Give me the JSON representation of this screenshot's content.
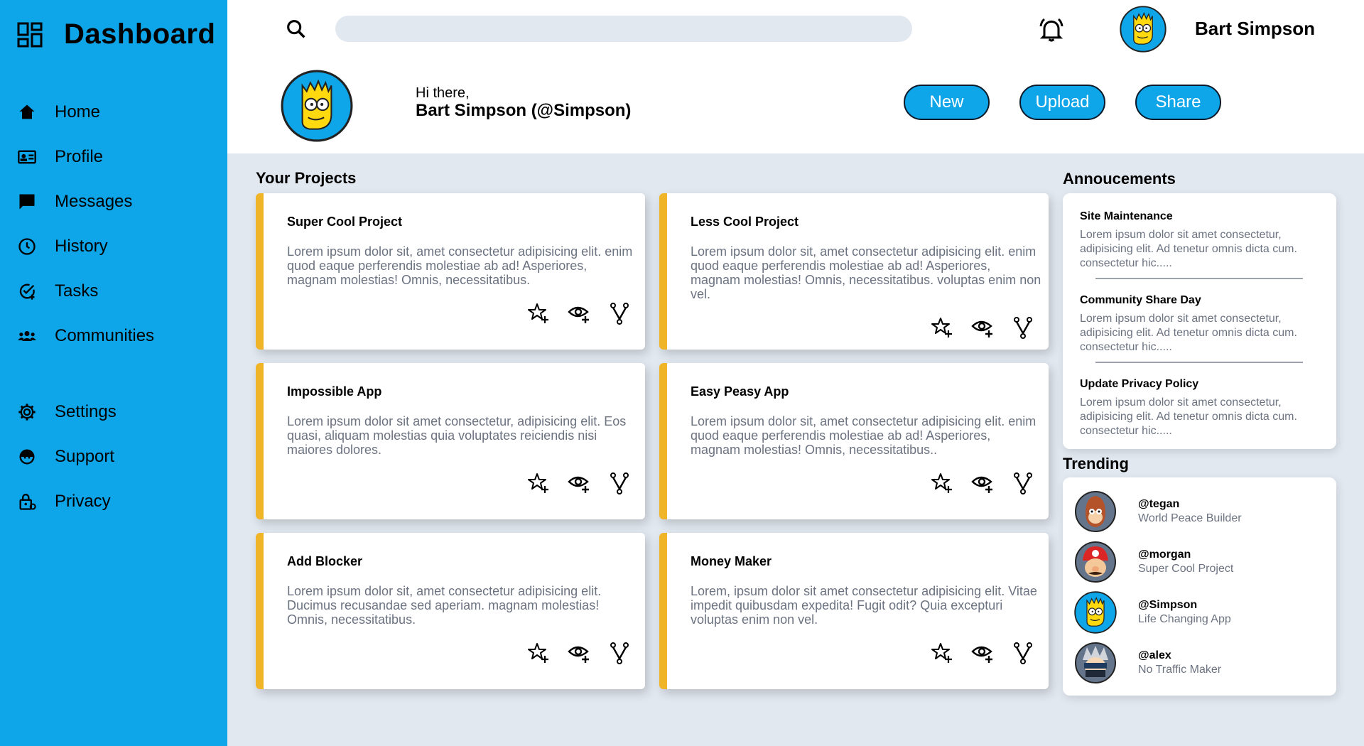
{
  "sidebar": {
    "title": "Dashboard",
    "items": [
      {
        "label": "Home"
      },
      {
        "label": "Profile"
      },
      {
        "label": "Messages"
      },
      {
        "label": "History"
      },
      {
        "label": "Tasks"
      },
      {
        "label": "Communities"
      },
      {
        "label": "Settings"
      },
      {
        "label": "Support"
      },
      {
        "label": "Privacy"
      }
    ]
  },
  "header": {
    "search_value": "",
    "username": "Bart Simpson",
    "greeting": "Hi there,",
    "display_name": "Bart Simpson (@Simpson)",
    "buttons": {
      "new": "New",
      "upload": "Upload",
      "share": "Share"
    }
  },
  "projects": {
    "title": "Your Projects",
    "cards": [
      {
        "title": "Super Cool Project",
        "desc": "Lorem ipsum dolor sit, amet consectetur adipisicing elit. enim quod eaque perferendis molestiae ab ad! Asperiores, magnam molestias! Omnis, necessitatibus."
      },
      {
        "title": "Less Cool Project",
        "desc": "Lorem ipsum dolor sit, amet consectetur adipisicing elit. enim quod eaque perferendis molestiae ab ad! Asperiores, magnam molestias! Omnis, necessitatibus. voluptas enim non vel."
      },
      {
        "title": "Impossible App",
        "desc": "Lorem ipsum dolor sit amet consectetur, adipisicing elit. Eos quasi, aliquam molestias quia voluptates reiciendis nisi maiores dolores."
      },
      {
        "title": "Easy Peasy App",
        "desc": "Lorem ipsum dolor sit, amet consectetur adipisicing elit. enim quod eaque perferendis molestiae ab ad! Asperiores, magnam molestias! Omnis, necessitatibus.."
      },
      {
        "title": "Add Blocker",
        "desc": "Lorem ipsum dolor sit, amet consectetur adipisicing elit. Ducimus recusandae sed aperiam. magnam molestias! Omnis, necessitatibus."
      },
      {
        "title": "Money Maker",
        "desc": "Lorem, ipsum dolor sit amet consectetur adipisicing elit. Vitae impedit quibusdam expedita! Fugit odit? Quia excepturi voluptas enim non vel."
      }
    ]
  },
  "announcements": {
    "title": "Annoucements",
    "items": [
      {
        "title": "Site Maintenance",
        "text": "Lorem ipsum dolor sit amet consectetur, adipisicing elit. Ad tenetur omnis dicta cum. consectetur hic....."
      },
      {
        "title": "Community Share Day",
        "text": "Lorem ipsum dolor sit amet consectetur, adipisicing elit. Ad tenetur omnis dicta cum. consectetur hic....."
      },
      {
        "title": "Update Privacy Policy",
        "text": "Lorem ipsum dolor sit amet consectetur, adipisicing elit. Ad tenetur omnis dicta cum. consectetur hic....."
      }
    ]
  },
  "trending": {
    "title": "Trending",
    "items": [
      {
        "handle": "@tegan",
        "project": "World Peace Builder"
      },
      {
        "handle": "@morgan",
        "project": "Super Cool Project"
      },
      {
        "handle": "@Simpson",
        "project": "Life Changing App"
      },
      {
        "handle": "@alex",
        "project": "No Traffic Maker"
      }
    ]
  },
  "colors": {
    "accent": "#0ea5e9",
    "card_stripe": "#f0b429",
    "background": "#e2e8f0"
  }
}
